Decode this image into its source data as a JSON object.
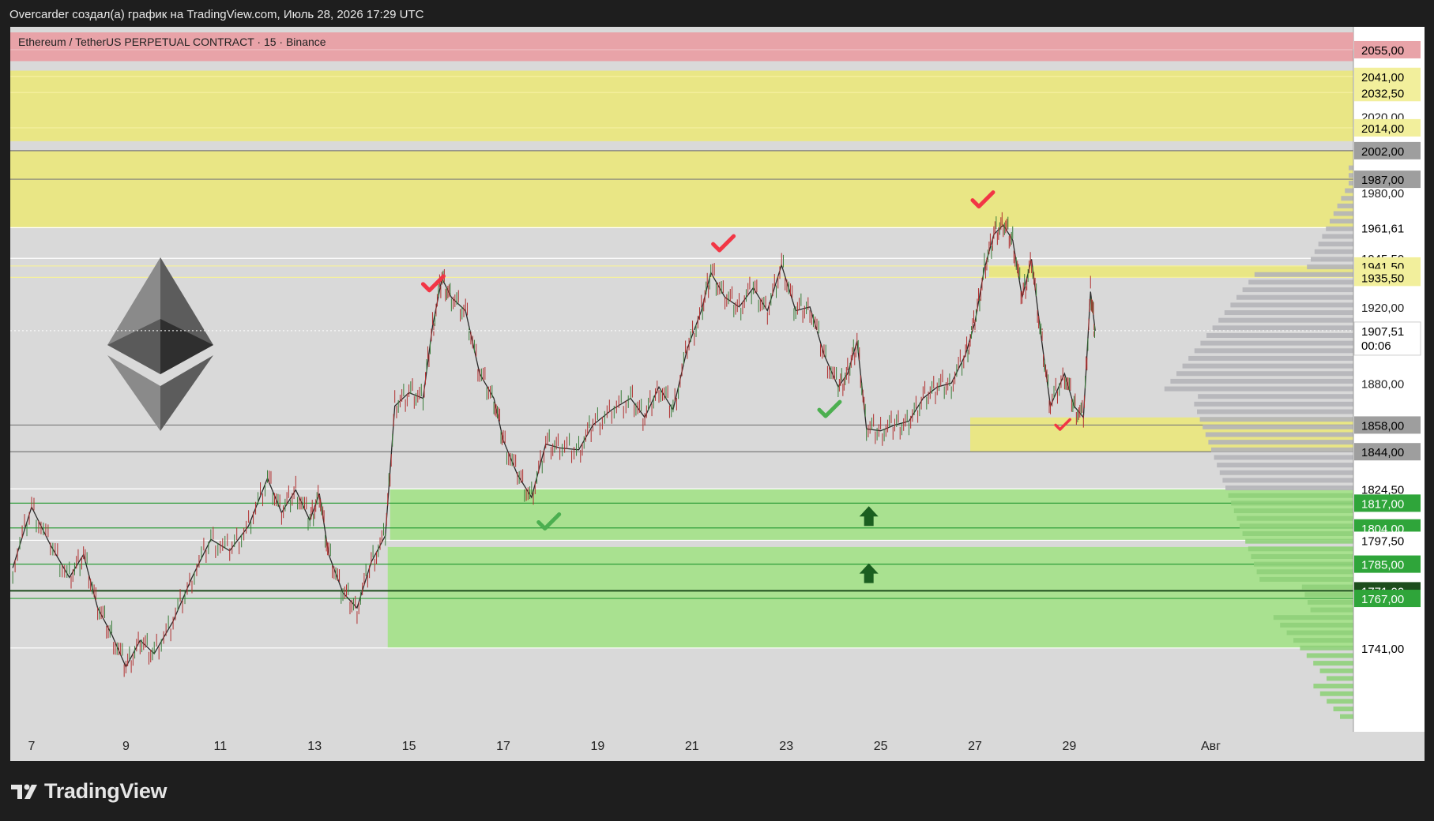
{
  "header": {
    "caption": "Overcarder создал(а) график на TradingView.com, Июль 28, 2026 17:29 UTC"
  },
  "symbol": {
    "title": "Ethereum / TetherUS PERPETUAL CONTRACT · 15 · Binance"
  },
  "logo": {
    "text": "TradingView"
  },
  "colors": {
    "background": "#d9d9d9",
    "yellow_zone": "#e9e685",
    "green_zone": "#a9e190",
    "red_zone": "#e8a3a8",
    "check_red": "#f23645",
    "check_green": "#4caf50",
    "arrow_green": "#1b5e20"
  },
  "chart_data": {
    "type": "line",
    "title": "",
    "xlabel": "",
    "ylabel": "",
    "ylim": [
      1697,
      2067
    ],
    "x_ticks": [
      {
        "label": "7",
        "day": 7
      },
      {
        "label": "9",
        "day": 9
      },
      {
        "label": "11",
        "day": 11
      },
      {
        "label": "13",
        "day": 13
      },
      {
        "label": "15",
        "day": 15
      },
      {
        "label": "17",
        "day": 17
      },
      {
        "label": "19",
        "day": 19
      },
      {
        "label": "21",
        "day": 21
      },
      {
        "label": "23",
        "day": 23
      },
      {
        "label": "25",
        "day": 25
      },
      {
        "label": "27",
        "day": 27
      },
      {
        "label": "29",
        "day": 29
      },
      {
        "label": "Авг",
        "day": 32
      }
    ],
    "price_labels": [
      {
        "text": "2055,00",
        "value": 2055.0,
        "kind": "red"
      },
      {
        "text": "2041,00",
        "value": 2041.0,
        "kind": "yellow"
      },
      {
        "text": "2032,50",
        "value": 2032.5,
        "kind": "yellow"
      },
      {
        "text": "2020,00",
        "value": 2020.0,
        "kind": "plain"
      },
      {
        "text": "2014,00",
        "value": 2014.0,
        "kind": "yellow"
      },
      {
        "text": "2002,00",
        "value": 2002.0,
        "kind": "gray"
      },
      {
        "text": "1987,00",
        "value": 1987.0,
        "kind": "gray"
      },
      {
        "text": "1980,00",
        "value": 1980.0,
        "kind": "plain"
      },
      {
        "text": "1961,61",
        "value": 1961.61,
        "kind": "white"
      },
      {
        "text": "1945,50",
        "value": 1945.5,
        "kind": "white"
      },
      {
        "text": "1941,50",
        "value": 1941.5,
        "kind": "yellow"
      },
      {
        "text": "1935,50",
        "value": 1935.5,
        "kind": "yellow"
      },
      {
        "text": "1920,00",
        "value": 1920.0,
        "kind": "plain"
      },
      {
        "text": "1880,00",
        "value": 1880.0,
        "kind": "plain"
      },
      {
        "text": "1858,00",
        "value": 1858.0,
        "kind": "gray"
      },
      {
        "text": "1844,00",
        "value": 1844.0,
        "kind": "gray"
      },
      {
        "text": "1824,50",
        "value": 1824.5,
        "kind": "white"
      },
      {
        "text": "1817,00",
        "value": 1817.0,
        "kind": "green"
      },
      {
        "text": "1804,00",
        "value": 1804.0,
        "kind": "green"
      },
      {
        "text": "1797,50",
        "value": 1797.5,
        "kind": "white"
      },
      {
        "text": "1785,00",
        "value": 1785.0,
        "kind": "green"
      },
      {
        "text": "1771,00",
        "value": 1771.0,
        "kind": "darkgreen"
      },
      {
        "text": "1767,00",
        "value": 1767.0,
        "kind": "green"
      },
      {
        "text": "1741,00",
        "value": 1741.0,
        "kind": "white"
      }
    ],
    "last_price": {
      "text": "1907,51",
      "value": 1907.51,
      "countdown": "00:06"
    },
    "zones": [
      {
        "name": "resistance-red",
        "from": 2049,
        "to": 2059,
        "color": "red"
      },
      {
        "name": "resistance-upper",
        "from": 2007,
        "to": 2044,
        "color": "yellow"
      },
      {
        "name": "resistance-lower",
        "from": 1961.61,
        "to": 2002,
        "color": "yellow"
      },
      {
        "name": "small-resistance",
        "from": 1935.5,
        "to": 1941.5,
        "color": "yellow",
        "day_from": 27.3
      },
      {
        "name": "support-yellow",
        "from": 1844,
        "to": 1862,
        "color": "yellow",
        "day_from": 26.9
      },
      {
        "name": "demand-1",
        "from": 1797.5,
        "to": 1824.5,
        "color": "green",
        "day_from": 14.6
      },
      {
        "name": "demand-2",
        "from": 1741,
        "to": 1794,
        "color": "green",
        "day_from": 14.55
      }
    ],
    "price_path": [
      [
        6.6,
        1783
      ],
      [
        7.0,
        1815
      ],
      [
        7.4,
        1795
      ],
      [
        7.8,
        1778
      ],
      [
        8.1,
        1790
      ],
      [
        8.4,
        1762
      ],
      [
        8.7,
        1748
      ],
      [
        9.0,
        1731
      ],
      [
        9.3,
        1745
      ],
      [
        9.6,
        1738
      ],
      [
        10.0,
        1755
      ],
      [
        10.4,
        1778
      ],
      [
        10.8,
        1798
      ],
      [
        11.2,
        1792
      ],
      [
        11.6,
        1805
      ],
      [
        12.0,
        1830
      ],
      [
        12.3,
        1812
      ],
      [
        12.6,
        1824
      ],
      [
        12.9,
        1808
      ],
      [
        13.1,
        1822
      ],
      [
        13.3,
        1790
      ],
      [
        13.6,
        1770
      ],
      [
        13.9,
        1762
      ],
      [
        14.2,
        1786
      ],
      [
        14.5,
        1800
      ],
      [
        14.7,
        1868
      ],
      [
        15.0,
        1875
      ],
      [
        15.3,
        1872
      ],
      [
        15.5,
        1910
      ],
      [
        15.7,
        1935
      ],
      [
        15.9,
        1925
      ],
      [
        16.2,
        1918
      ],
      [
        16.5,
        1885
      ],
      [
        16.8,
        1872
      ],
      [
        17.0,
        1850
      ],
      [
        17.3,
        1832
      ],
      [
        17.6,
        1820
      ],
      [
        17.9,
        1848
      ],
      [
        18.2,
        1846
      ],
      [
        18.6,
        1845
      ],
      [
        18.9,
        1858
      ],
      [
        19.3,
        1866
      ],
      [
        19.7,
        1872
      ],
      [
        20.0,
        1862
      ],
      [
        20.3,
        1878
      ],
      [
        20.6,
        1866
      ],
      [
        20.9,
        1898
      ],
      [
        21.2,
        1918
      ],
      [
        21.4,
        1938
      ],
      [
        21.7,
        1925
      ],
      [
        22.0,
        1920
      ],
      [
        22.3,
        1930
      ],
      [
        22.6,
        1918
      ],
      [
        22.9,
        1942
      ],
      [
        23.2,
        1918
      ],
      [
        23.5,
        1920
      ],
      [
        23.8,
        1895
      ],
      [
        24.1,
        1878
      ],
      [
        24.3,
        1885
      ],
      [
        24.5,
        1902
      ],
      [
        24.7,
        1856
      ],
      [
        25.0,
        1855
      ],
      [
        25.3,
        1858
      ],
      [
        25.6,
        1860
      ],
      [
        25.9,
        1872
      ],
      [
        26.2,
        1878
      ],
      [
        26.5,
        1880
      ],
      [
        26.8,
        1895
      ],
      [
        27.0,
        1912
      ],
      [
        27.2,
        1940
      ],
      [
        27.4,
        1958
      ],
      [
        27.6,
        1963
      ],
      [
        27.8,
        1955
      ],
      [
        28.0,
        1925
      ],
      [
        28.2,
        1945
      ],
      [
        28.4,
        1905
      ],
      [
        28.6,
        1868
      ],
      [
        28.9,
        1885
      ],
      [
        29.1,
        1868
      ],
      [
        29.3,
        1862
      ],
      [
        29.45,
        1928
      ],
      [
        29.55,
        1907.51
      ]
    ],
    "markers": [
      {
        "type": "check-red",
        "day": 15.5,
        "price": 1932
      },
      {
        "type": "check-red",
        "day": 21.65,
        "price": 1953
      },
      {
        "type": "check-red",
        "day": 27.15,
        "price": 1976
      },
      {
        "type": "check-red-small",
        "day": 28.85,
        "price": 1858
      },
      {
        "type": "check-green",
        "day": 17.95,
        "price": 1807
      },
      {
        "type": "check-green",
        "day": 23.9,
        "price": 1866
      },
      {
        "type": "arrow-up",
        "day": 24.75,
        "price": 1810
      },
      {
        "type": "arrow-up",
        "day": 24.75,
        "price": 1780
      }
    ]
  }
}
